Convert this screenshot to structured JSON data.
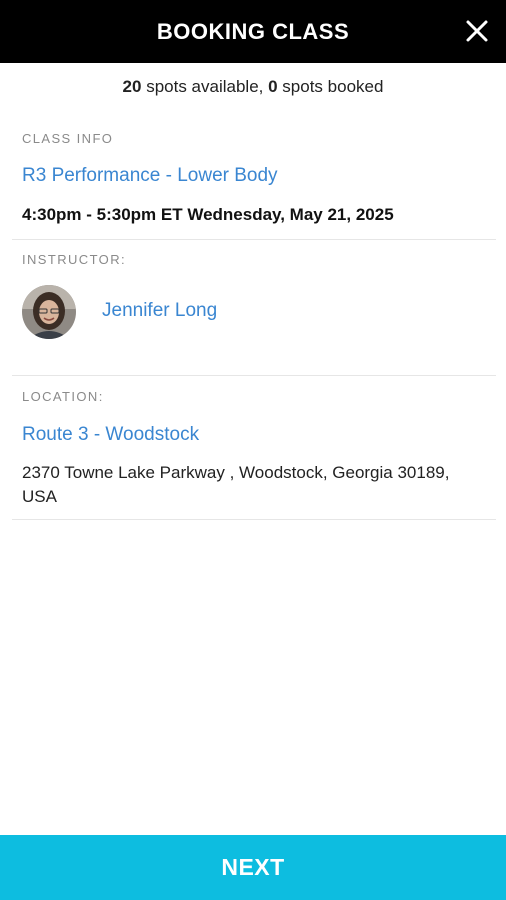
{
  "header": {
    "title": "BOOKING CLASS",
    "close_icon": "close-icon"
  },
  "availability": {
    "spots_available": "20",
    "available_text": " spots available, ",
    "spots_booked": "0",
    "booked_text": " spots booked"
  },
  "class_info": {
    "label": "CLASS INFO",
    "name": "R3 Performance - Lower Body",
    "time": "4:30pm - 5:30pm ET Wednesday, May 21, 2025"
  },
  "instructor": {
    "label": "INSTRUCTOR:",
    "name": "Jennifer Long"
  },
  "location": {
    "label": "LOCATION:",
    "name": "Route 3 - Woodstock",
    "address": "2370 Towne Lake Parkway , Woodstock, Georgia 30189, USA"
  },
  "footer": {
    "next_label": "NEXT"
  },
  "colors": {
    "header_bg": "#000000",
    "link": "#3a86d1",
    "next_bg": "#0dbde0"
  }
}
